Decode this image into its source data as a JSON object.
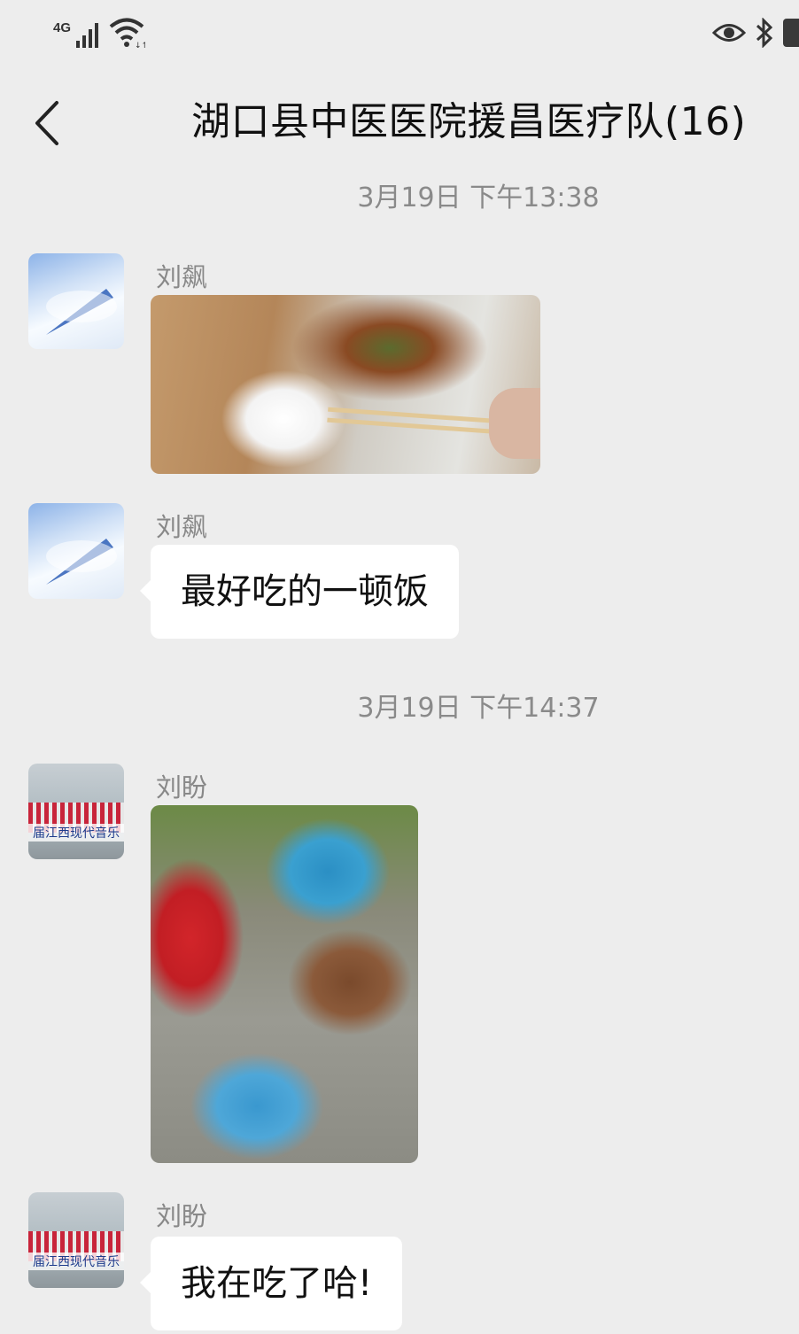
{
  "status_bar": {
    "network_label": "4G",
    "icons": [
      "signal-icon",
      "wifi-icon",
      "eye-icon",
      "bluetooth-icon",
      "battery-icon"
    ]
  },
  "header": {
    "title": "湖口县中医医院援昌医疗队(16)",
    "back_icon": "chevron-left-icon"
  },
  "messages": [
    {
      "type": "timestamp",
      "text": "3月19日 下午13:38"
    },
    {
      "type": "image",
      "sender": "刘飙",
      "avatar": "sky-avatar",
      "image": "boxed-meal-with-chopsticks-photo"
    },
    {
      "type": "text",
      "sender": "刘飙",
      "avatar": "sky-avatar",
      "text": "最好吃的一顿饭"
    },
    {
      "type": "timestamp",
      "text": "3月19日 下午14:37"
    },
    {
      "type": "image",
      "sender": "刘盼",
      "avatar": "banner-avatar",
      "image": "team-eating-outdoors-photo",
      "avatar_text": "届江西现代音乐"
    },
    {
      "type": "text",
      "sender": "刘盼",
      "avatar": "banner-avatar",
      "text": "我在吃了哈!",
      "avatar_text": "届江西现代音乐"
    }
  ],
  "colors": {
    "background": "#ededed",
    "bubble": "#ffffff",
    "timestamp_text": "#8a8a8a",
    "sender_text": "#888888"
  }
}
